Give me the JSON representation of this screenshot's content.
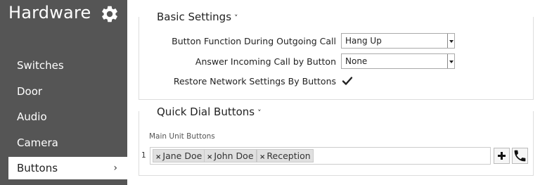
{
  "sidebar": {
    "title": "Hardware",
    "items": [
      {
        "label": "Switches"
      },
      {
        "label": "Door"
      },
      {
        "label": "Audio"
      },
      {
        "label": "Camera"
      },
      {
        "label": "Buttons",
        "active": true,
        "chevron": "›"
      }
    ]
  },
  "basic_settings": {
    "title": "Basic Settings",
    "caret": "˅",
    "button_function_label": "Button Function During Outgoing Call",
    "button_function_value": "Hang Up",
    "answer_incoming_label": "Answer Incoming Call by Button",
    "answer_incoming_value": "None",
    "restore_network_label": "Restore Network Settings By Buttons",
    "restore_network_checked": true
  },
  "quick_dial": {
    "title": "Quick Dial Buttons",
    "caret": "˅",
    "sub_label": "Main Unit Buttons",
    "rows": [
      {
        "number": "1",
        "tags": [
          "Jane Doe",
          "John Doe",
          "Reception"
        ]
      }
    ],
    "add_icon": "plus-icon",
    "call_icon": "phone-icon"
  },
  "colors": {
    "sidebar_bg": "#555555",
    "active_item_bg": "#ffffff",
    "tag_bg": "#e0e0e0"
  }
}
